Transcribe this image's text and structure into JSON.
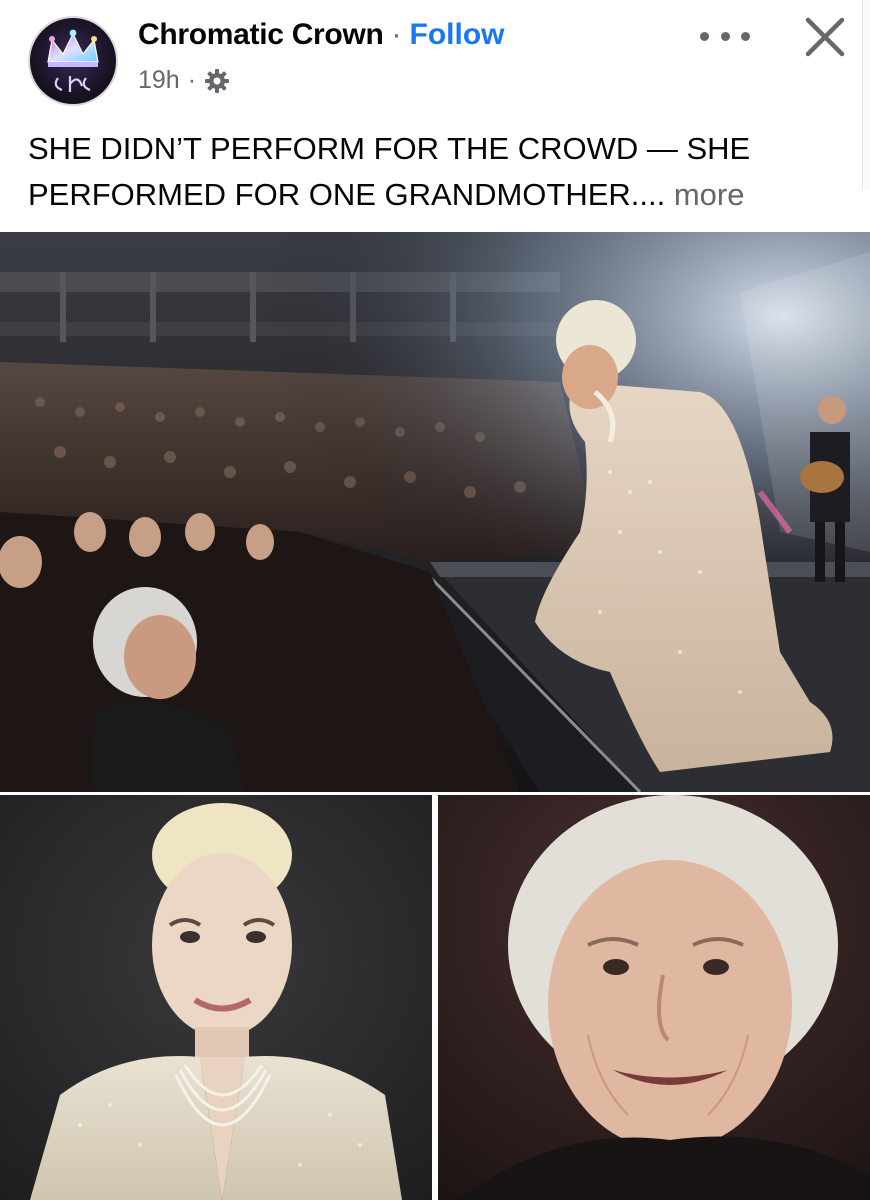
{
  "post": {
    "page_name": "Chromatic Crown",
    "separator": "·",
    "follow_label": "Follow",
    "time": "19h",
    "meta_separator": "·",
    "audience_icon": "gear-icon",
    "caption": "SHE DIDN’T PERFORM FOR THE CROWD — SHE PERFORMED FOR ONE GRANDMOTHER....",
    "more_label": "more"
  },
  "colors": {
    "link_blue": "#1877f2",
    "secondary_text": "#65676b",
    "primary_text": "#050505"
  },
  "icons": {
    "avatar": "crown-logo",
    "more": "more-dots-icon",
    "close": "close-icon"
  }
}
